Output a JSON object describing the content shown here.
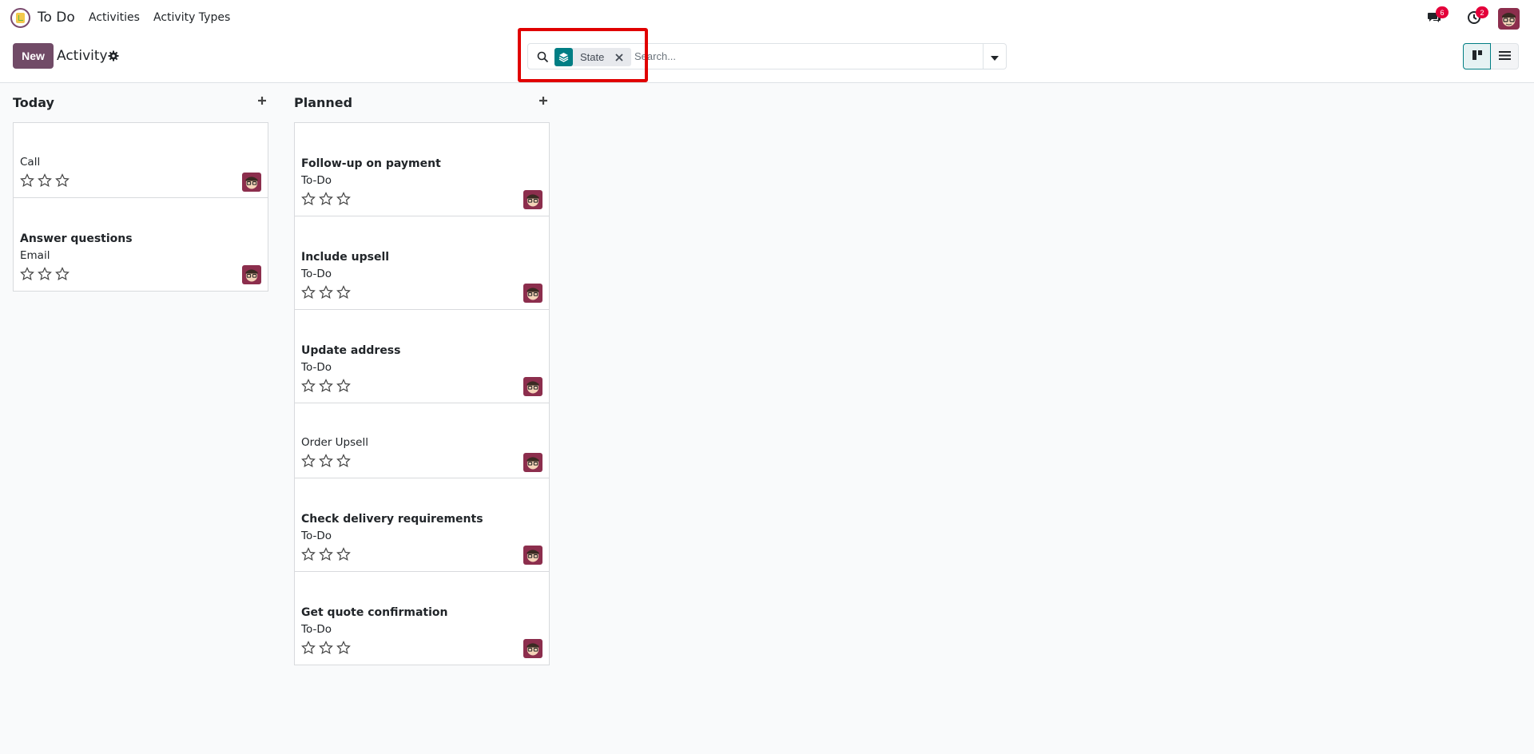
{
  "navbar": {
    "app_name": "To Do",
    "menu": [
      "Activities",
      "Activity Types"
    ],
    "messages_count": "6",
    "activities_count": "2"
  },
  "control": {
    "new_label": "New",
    "breadcrumb": "Activity",
    "search": {
      "facet_label": "State",
      "placeholder": "Search..."
    }
  },
  "columns": [
    {
      "title": "Today",
      "cards": [
        {
          "title": "",
          "type": "Call"
        },
        {
          "title": "Answer questions",
          "type": "Email"
        }
      ]
    },
    {
      "title": "Planned",
      "cards": [
        {
          "title": "Follow-up on payment",
          "type": "To-Do"
        },
        {
          "title": "Include upsell",
          "type": "To-Do"
        },
        {
          "title": "Update address",
          "type": "To-Do"
        },
        {
          "title": "",
          "type": "Order Upsell"
        },
        {
          "title": "Check delivery requirements",
          "type": "To-Do"
        },
        {
          "title": "Get quote confirmation",
          "type": "To-Do"
        }
      ]
    }
  ],
  "colors": {
    "primary": "#714b67",
    "accent": "#017e84",
    "badge": "#e4003a",
    "highlight": "#e00000"
  }
}
